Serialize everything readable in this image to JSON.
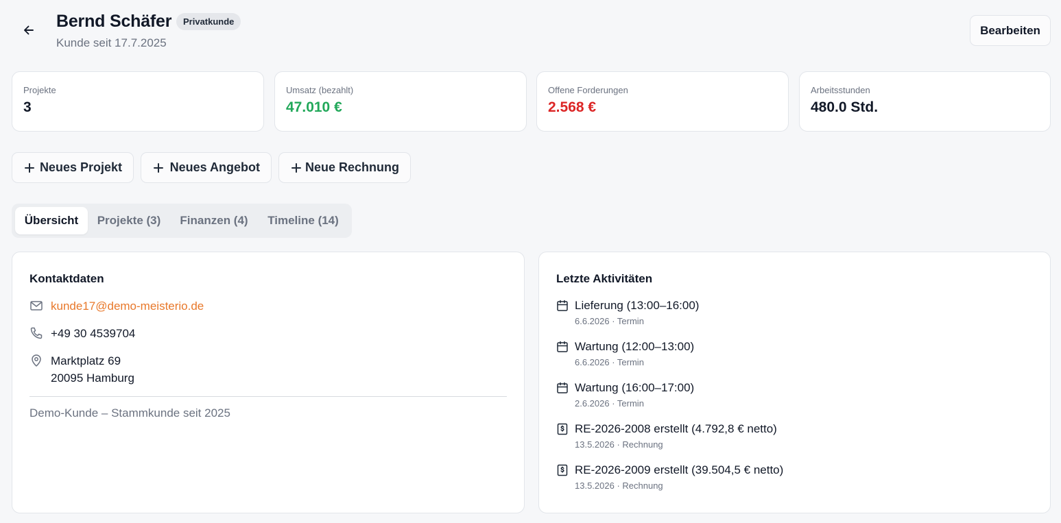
{
  "header": {
    "title": "Bernd Schäfer",
    "badge": "Privatkunde",
    "subtitle": "Kunde seit 17.7.2025",
    "edit_label": "Bearbeiten"
  },
  "stats": [
    {
      "label": "Projekte",
      "value": "3",
      "color": "#111827"
    },
    {
      "label": "Umsatz (bezahlt)",
      "value": "47.010 €",
      "color": "#22a85a"
    },
    {
      "label": "Offene Forderungen",
      "value": "2.568 €",
      "color": "#dc2626"
    },
    {
      "label": "Arbeitsstunden",
      "value": "480.0 Std.",
      "color": "#111827"
    }
  ],
  "actions": {
    "new_project": "Neues Projekt",
    "new_offer": "Neues Angebot",
    "new_invoice": "Neue Rechnung"
  },
  "tabs": [
    {
      "label": "Übersicht",
      "active": true
    },
    {
      "label": "Projekte (3)",
      "active": false
    },
    {
      "label": "Finanzen (4)",
      "active": false
    },
    {
      "label": "Timeline (14)",
      "active": false
    }
  ],
  "contact": {
    "title": "Kontaktdaten",
    "email": "kunde17@demo-meisterio.de",
    "phone": "+49 30 4539704",
    "street": "Marktplatz 69",
    "city": "20095 Hamburg",
    "note": "Demo-Kunde – Stammkunde seit 2025"
  },
  "activities": {
    "title": "Letzte Aktivitäten",
    "items": [
      {
        "icon": "calendar-icon",
        "title": "Lieferung (13:00–16:00)",
        "meta": "6.6.2026 · Termin"
      },
      {
        "icon": "calendar-icon",
        "title": "Wartung (12:00–13:00)",
        "meta": "6.6.2026 · Termin"
      },
      {
        "icon": "calendar-icon",
        "title": "Wartung (16:00–17:00)",
        "meta": "2.6.2026 · Termin"
      },
      {
        "icon": "invoice-icon",
        "title": "RE-2026-2008 erstellt (4.792,8 € netto)",
        "meta": "13.5.2026 · Rechnung"
      },
      {
        "icon": "invoice-icon",
        "title": "RE-2026-2009 erstellt (39.504,5 € netto)",
        "meta": "13.5.2026 · Rechnung"
      }
    ]
  }
}
